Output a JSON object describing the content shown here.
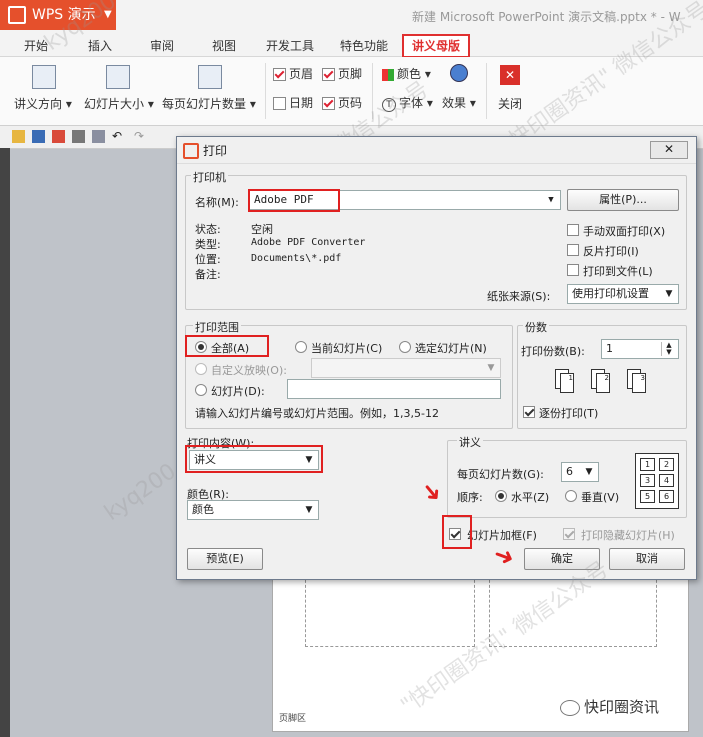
{
  "app": {
    "name": "WPS 演示",
    "doc_title": "新建 Microsoft PowerPoint 演示文稿.pptx * - W"
  },
  "tabs": [
    "开始",
    "插入",
    "审阅",
    "视图",
    "开发工具",
    "特色功能",
    "讲义母版"
  ],
  "ribbon": {
    "handout_direction": "讲义方向",
    "slide_size": "幻灯片大小",
    "slides_per_page": "每页幻灯片数量",
    "header": "页眉",
    "footer": "页脚",
    "date": "日期",
    "page_number": "页码",
    "color": "颜色",
    "font": "字体",
    "effect": "效果",
    "close": "关闭"
  },
  "dialog": {
    "title": "打印",
    "close_label": "关闭",
    "printer": {
      "group_label": "打印机",
      "name_label": "名称(M):",
      "name_value": "Adobe PDF",
      "properties_button": "属性(P)...",
      "status_label": "状态:",
      "status_value": "空闲",
      "type_label": "类型:",
      "type_value": "Adobe PDF Converter",
      "location_label": "位置:",
      "location_value": "Documents\\*.pdf",
      "comment_label": "备注:",
      "manual_duplex": "手动双面打印(X)",
      "reverse_print": "反片打印(I)",
      "print_to_file": "打印到文件(L)",
      "paper_source_label": "纸张来源(S):",
      "paper_source_value": "使用打印机设置"
    },
    "range": {
      "group_label": "打印范围",
      "all": "全部(A)",
      "current_slide": "当前幻灯片(C)",
      "selected_slide": "选定幻灯片(N)",
      "custom_show": "自定义放映(O):",
      "slides": "幻灯片(D):",
      "hint": "请输入幻灯片编号或幻灯片范围。例如，1,3,5-12"
    },
    "copies": {
      "group_label": "份数",
      "count_label": "打印份数(B):",
      "count_value": "1",
      "collate": "逐份打印(T)"
    },
    "content": {
      "label": "打印内容(W):",
      "value": "讲义",
      "color_label": "颜色(R):",
      "color_value": "颜色"
    },
    "handout": {
      "group_label": "讲义",
      "per_page_label": "每页幻灯片数(G):",
      "per_page_value": "6",
      "order_label": "顺序:",
      "horizontal": "水平(Z)",
      "vertical": "垂直(V)",
      "grid_numbers": [
        "1",
        "2",
        "3",
        "4",
        "5",
        "6"
      ]
    },
    "frame_slides": "幻灯片加框(F)",
    "print_hidden": "打印隐藏幻灯片(H)",
    "preview_button": "预览(E)",
    "ok_button": "确定",
    "cancel_button": "取消"
  },
  "slide_footer": "页脚区",
  "wechat_label": "快印圈资讯",
  "watermarks": [
    "kyq200",
    "\"快印圈资讯\" 微信公众号"
  ],
  "colors": {
    "accent": "#e5502c",
    "highlight": "#e02020"
  }
}
